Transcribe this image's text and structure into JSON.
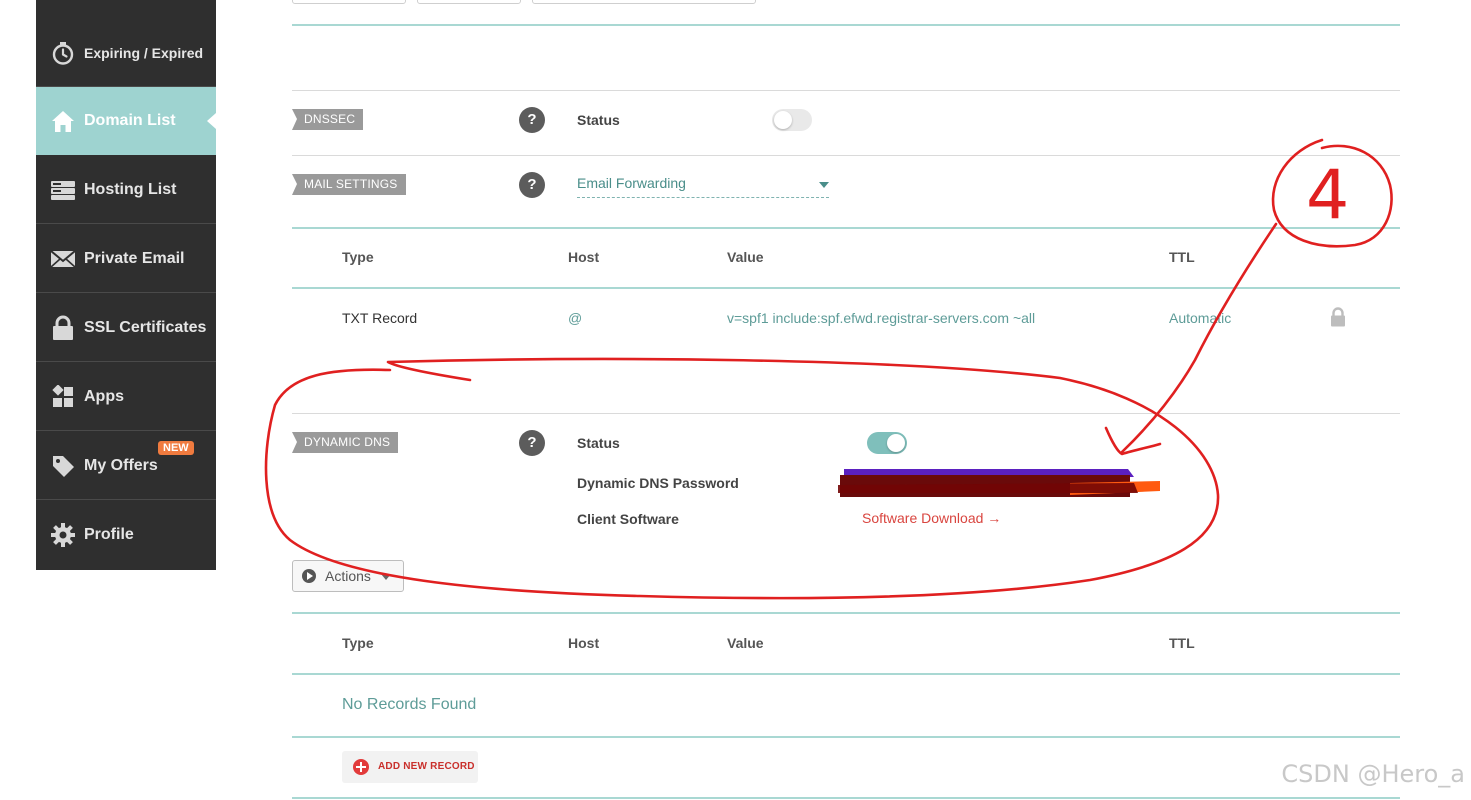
{
  "sidebar": {
    "items": [
      {
        "label": "Expiring / Expired",
        "icon": "stopwatch-icon"
      },
      {
        "label": "Domain List",
        "icon": "home-icon",
        "active": true
      },
      {
        "label": "Hosting List",
        "icon": "server-icon"
      },
      {
        "label": "Private Email",
        "icon": "envelope-icon"
      },
      {
        "label": "SSL Certificates",
        "icon": "lock-icon"
      },
      {
        "label": "Apps",
        "icon": "apps-grid-icon"
      },
      {
        "label": "My Offers",
        "icon": "tag-icon",
        "badge": "NEW"
      },
      {
        "label": "Profile",
        "icon": "gear-icon"
      }
    ]
  },
  "dnssec": {
    "tag": "DNSSEC",
    "status_label": "Status",
    "enabled": false
  },
  "mail_settings": {
    "tag": "MAIL SETTINGS",
    "selected": "Email Forwarding"
  },
  "mail_table": {
    "headers": [
      "Type",
      "Host",
      "Value",
      "TTL"
    ],
    "rows": [
      {
        "type": "TXT Record",
        "host": "@",
        "value": "v=spf1 include:spf.efwd.registrar-servers.com ~all",
        "ttl": "Automatic",
        "locked": true
      }
    ]
  },
  "dynamic_dns": {
    "tag": "DYNAMIC DNS",
    "status_label": "Status",
    "enabled": true,
    "password_label": "Dynamic DNS Password",
    "client_label": "Client Software",
    "client_link": "Software Download →"
  },
  "actions": {
    "label": "Actions"
  },
  "records_table": {
    "headers": [
      "Type",
      "Host",
      "Value",
      "TTL"
    ],
    "empty_text": "No Records Found",
    "add_label": "ADD NEW RECORD"
  },
  "annotation": {
    "number": "4",
    "color": "#e02020"
  },
  "watermark": "CSDN @Hero_a",
  "colors": {
    "sidebar_bg": "#2f2f2f",
    "active_bg": "#9ed3d0",
    "teal_line": "#a9d8d3",
    "link_red": "#d9453f"
  }
}
